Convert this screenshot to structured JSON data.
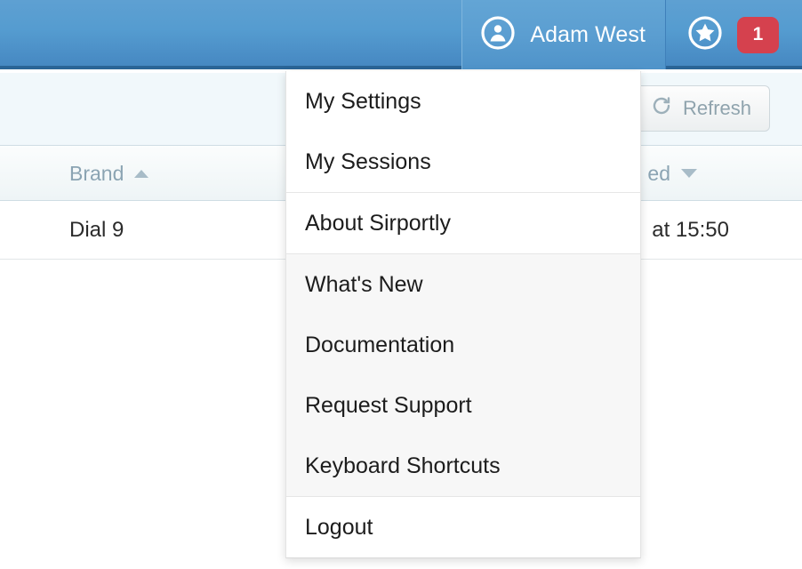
{
  "header": {
    "user_tab": {
      "name": "Adam West",
      "avatar_icon": "user-circle-icon"
    },
    "favourites_icon": "star-circle-icon",
    "notification_badge": "1",
    "badge_color": "#d5414e",
    "accent_color": "#559cd0"
  },
  "toolbar": {
    "refresh_label": "Refresh",
    "refresh_icon": "refresh-icon"
  },
  "table": {
    "columns": [
      {
        "label": "Brand",
        "sort": "asc",
        "sort_icon": "caret-up-icon"
      },
      {
        "label": "ed",
        "sort": "desc",
        "sort_icon": "caret-down-icon"
      }
    ],
    "rows": [
      {
        "brand": "Dial 9",
        "updated": "at 15:50"
      }
    ]
  },
  "menu": {
    "groups": [
      {
        "style": "plain",
        "items": [
          {
            "label": "My Settings"
          },
          {
            "label": "My Sessions"
          }
        ]
      },
      {
        "style": "divided",
        "items": [
          {
            "label": "About Sirportly"
          }
        ]
      },
      {
        "style": "shaded",
        "items": [
          {
            "label": "What's New"
          },
          {
            "label": "Documentation"
          },
          {
            "label": "Request Support"
          },
          {
            "label": "Keyboard Shortcuts"
          }
        ]
      },
      {
        "style": "plain",
        "items": [
          {
            "label": "Logout"
          }
        ]
      }
    ]
  }
}
